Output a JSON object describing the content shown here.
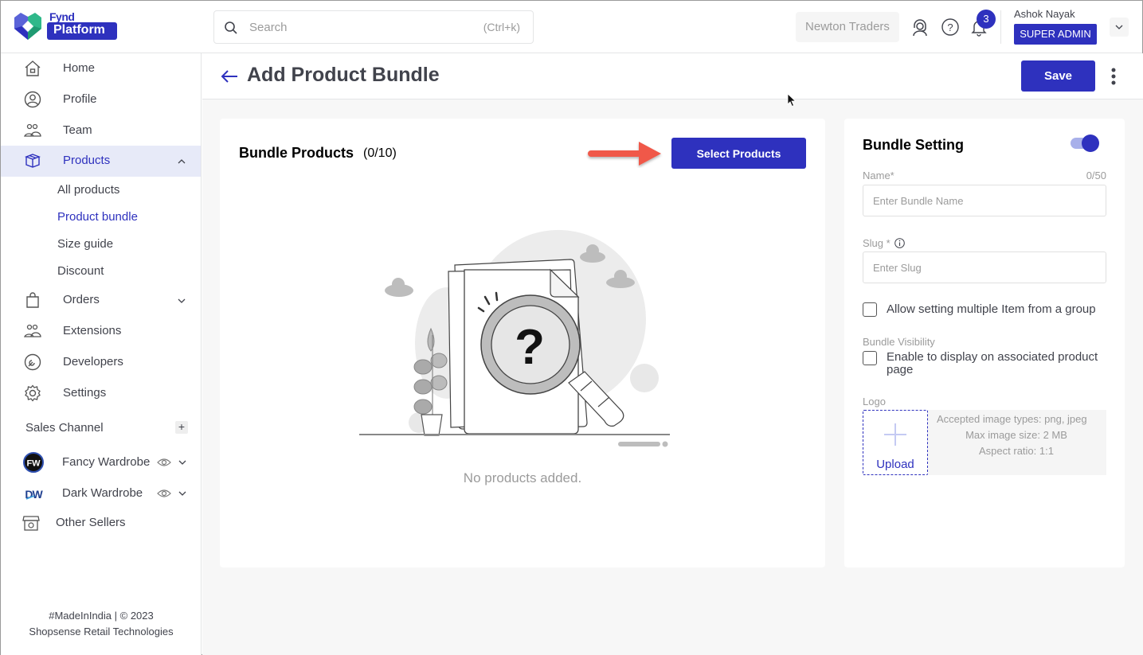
{
  "brand": {
    "top": "Fynd",
    "bottom": "Platform",
    "color": "#2e31be"
  },
  "search": {
    "placeholder": "Search",
    "shortcut": "(Ctrl+k)",
    "value": ""
  },
  "header": {
    "company": "Newton Traders",
    "notifications_count": "3",
    "user_name": "Ashok Nayak",
    "user_role": "SUPER ADMIN",
    "icons": [
      "support-icon",
      "help-icon",
      "bell-icon",
      "chevron-down-icon"
    ]
  },
  "sidebar": {
    "items": [
      {
        "label": "Home",
        "icon": "home-icon"
      },
      {
        "label": "Profile",
        "icon": "profile-icon"
      },
      {
        "label": "Team",
        "icon": "team-icon"
      },
      {
        "label": "Products",
        "icon": "box-icon",
        "expanded": true,
        "active": true
      },
      {
        "label": "Orders",
        "icon": "bag-icon",
        "expanded": false
      },
      {
        "label": "Extensions",
        "icon": "extensions-icon"
      },
      {
        "label": "Developers",
        "icon": "developers-icon"
      },
      {
        "label": "Settings",
        "icon": "gear-icon"
      }
    ],
    "products_sub": [
      {
        "label": "All products"
      },
      {
        "label": "Product bundle",
        "active": true
      },
      {
        "label": "Size guide"
      },
      {
        "label": "Discount"
      }
    ],
    "sales_channel_title": "Sales Channel",
    "sales_channels": [
      {
        "label": "Fancy Wardrobe",
        "logo": "FW"
      },
      {
        "label": "Dark Wardrobe",
        "logo": "DW"
      }
    ],
    "other_sellers": "Other Sellers",
    "footer_line1": "#MadeInIndia | © 2023",
    "footer_line2": "Shopsense Retail Technologies"
  },
  "page": {
    "title": "Add Product Bundle",
    "save_label": "Save"
  },
  "bundle_products": {
    "title": "Bundle Products",
    "count": "(0/10)",
    "select_label": "Select Products",
    "empty_text": "No products added."
  },
  "bundle_setting": {
    "title": "Bundle Setting",
    "enabled": true,
    "name_label": "Name*",
    "name_count": "0/50",
    "name_placeholder": "Enter Bundle Name",
    "name_value": "",
    "slug_label": "Slug *",
    "slug_placeholder": "Enter Slug",
    "slug_value": "",
    "multi_item_label": "Allow setting multiple Item from a group",
    "multi_item_checked": false,
    "visibility_title": "Bundle Visibility",
    "visibility_label": "Enable to display on associated product page",
    "visibility_checked": false,
    "logo_label": "Logo",
    "upload_label": "Upload",
    "upload_types": "Accepted image types: png, jpeg",
    "upload_size": "Max image size: 2 MB",
    "upload_ratio": "Aspect ratio: 1:1"
  }
}
